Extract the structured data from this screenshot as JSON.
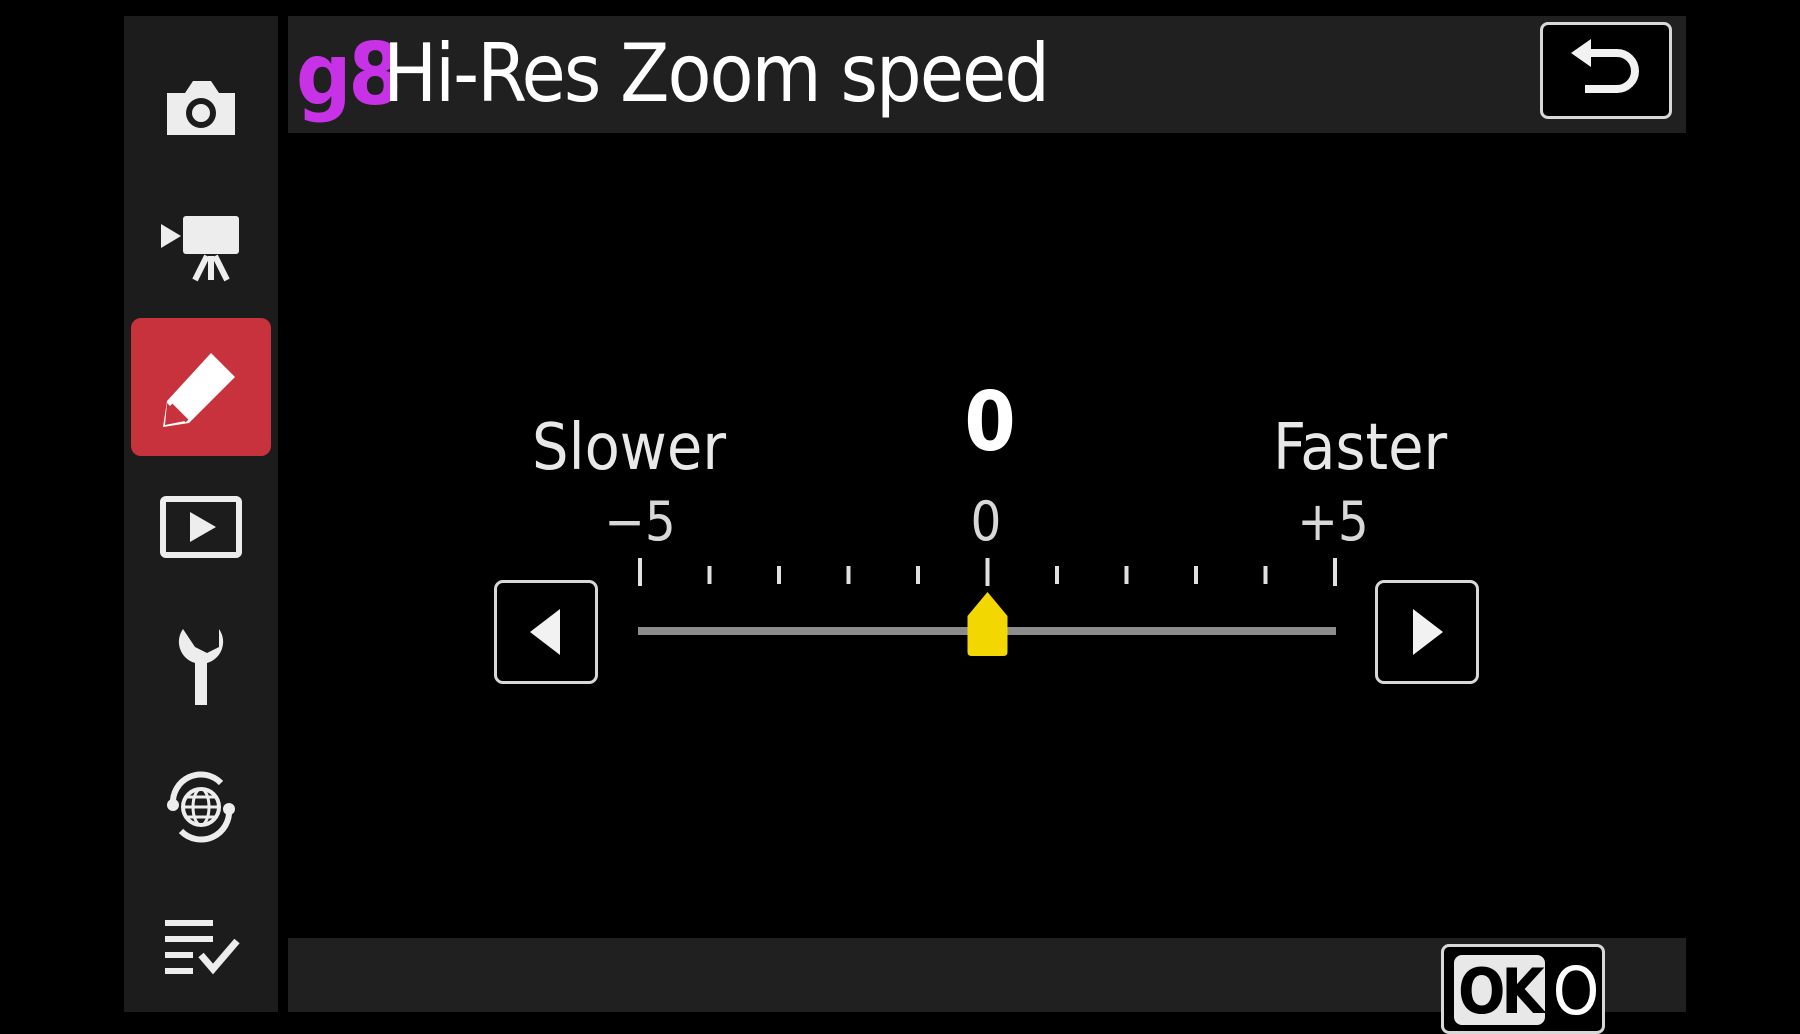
{
  "title": {
    "code": "g8",
    "text": "Hi-Res Zoom speed"
  },
  "colors": {
    "code": "#c832e6",
    "active_tab": "#c8323c",
    "indicator": "#f2d700"
  },
  "sidebar": {
    "items": [
      {
        "icon": "camera-icon",
        "active": false
      },
      {
        "icon": "movie-camera-icon",
        "active": false
      },
      {
        "icon": "pencil-icon",
        "active": true
      },
      {
        "icon": "playback-icon",
        "active": false
      },
      {
        "icon": "wrench-icon",
        "active": false
      },
      {
        "icon": "network-icon",
        "active": false
      },
      {
        "icon": "my-menu-icon",
        "active": false
      }
    ]
  },
  "slider": {
    "value_readout": "0",
    "left_label": "Slower",
    "right_label": "Faster",
    "tick_labels": {
      "min": "−5",
      "mid": "0",
      "max": "+5"
    },
    "min": -5,
    "max": 5,
    "value": 0
  },
  "bottom": {
    "ok_icon_text": "OK",
    "ok_label": "OK"
  },
  "back_icon": "back-arrow-icon"
}
